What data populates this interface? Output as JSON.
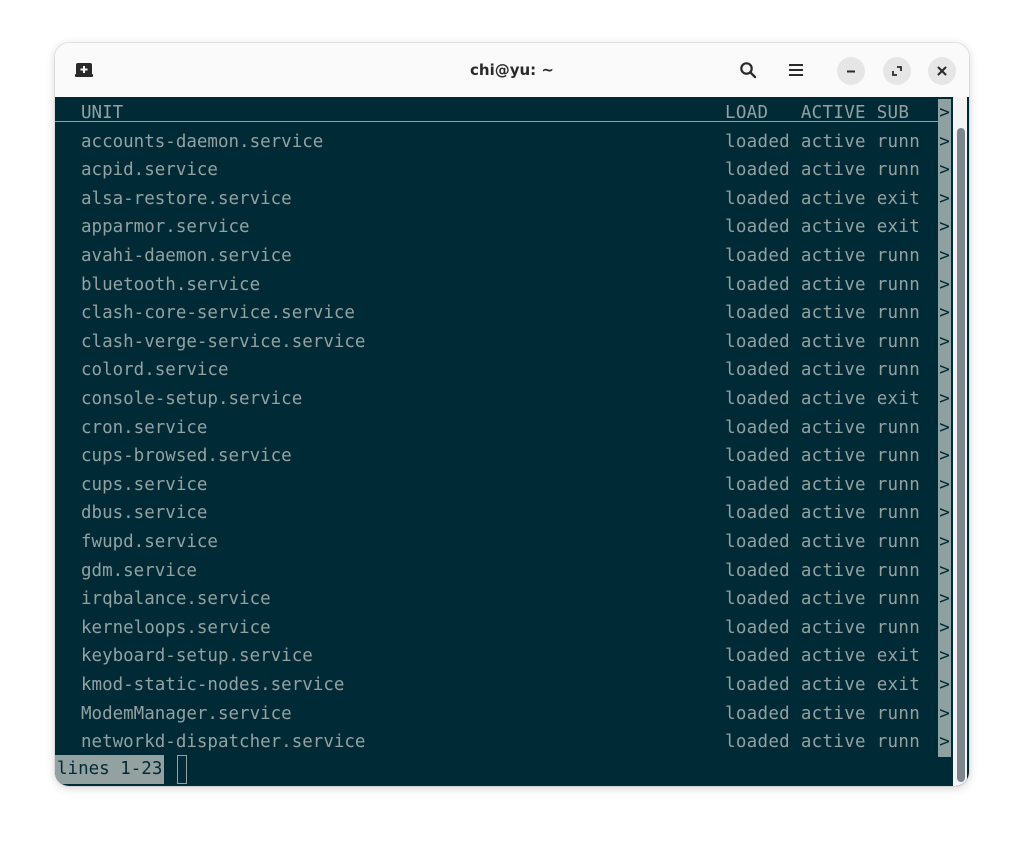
{
  "window": {
    "title": "chi@yu: ~",
    "icons": {
      "new_tab": "new-tab-icon",
      "search": "search-icon",
      "menu": "hamburger-menu-icon",
      "minimize": "minimize-icon",
      "maximize": "maximize-icon",
      "close": "close-icon"
    }
  },
  "terminal": {
    "header": {
      "unit": "UNIT",
      "rest": "LOAD   ACTIVE SUB "
    },
    "overflow_char": ">",
    "rows": [
      {
        "unit": "accounts-daemon.service",
        "rest": "loaded active runn"
      },
      {
        "unit": "acpid.service",
        "rest": "loaded active runn"
      },
      {
        "unit": "alsa-restore.service",
        "rest": "loaded active exit"
      },
      {
        "unit": "apparmor.service",
        "rest": "loaded active exit"
      },
      {
        "unit": "avahi-daemon.service",
        "rest": "loaded active runn"
      },
      {
        "unit": "bluetooth.service",
        "rest": "loaded active runn"
      },
      {
        "unit": "clash-core-service.service",
        "rest": "loaded active runn"
      },
      {
        "unit": "clash-verge-service.service",
        "rest": "loaded active runn"
      },
      {
        "unit": "colord.service",
        "rest": "loaded active runn"
      },
      {
        "unit": "console-setup.service",
        "rest": "loaded active exit"
      },
      {
        "unit": "cron.service",
        "rest": "loaded active runn"
      },
      {
        "unit": "cups-browsed.service",
        "rest": "loaded active runn"
      },
      {
        "unit": "cups.service",
        "rest": "loaded active runn"
      },
      {
        "unit": "dbus.service",
        "rest": "loaded active runn"
      },
      {
        "unit": "fwupd.service",
        "rest": "loaded active runn"
      },
      {
        "unit": "gdm.service",
        "rest": "loaded active runn"
      },
      {
        "unit": "irqbalance.service",
        "rest": "loaded active runn"
      },
      {
        "unit": "kerneloops.service",
        "rest": "loaded active runn"
      },
      {
        "unit": "keyboard-setup.service",
        "rest": "loaded active exit"
      },
      {
        "unit": "kmod-static-nodes.service",
        "rest": "loaded active exit"
      },
      {
        "unit": "ModemManager.service",
        "rest": "loaded active runn"
      },
      {
        "unit": "networkd-dispatcher.service",
        "rest": "loaded active runn"
      }
    ],
    "status": "lines 1-23"
  },
  "colors": {
    "terminal_bg": "#002b36",
    "terminal_fg": "#93a1a1",
    "titlebar_bg": "#fafafa"
  }
}
